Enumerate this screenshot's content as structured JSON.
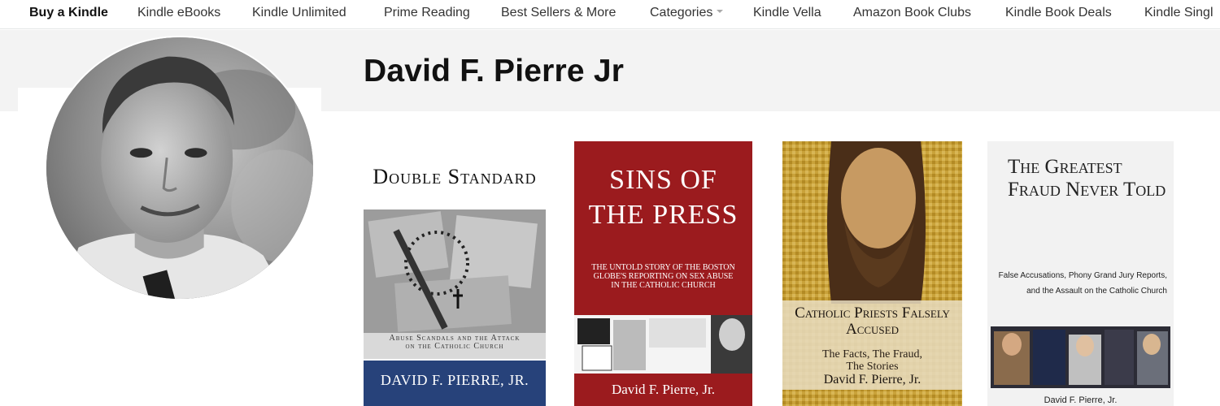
{
  "nav": {
    "items": [
      {
        "label": "Buy a Kindle",
        "active": true
      },
      {
        "label": "Kindle eBooks"
      },
      {
        "label": "Kindle Unlimited"
      },
      {
        "label": "Prime Reading"
      },
      {
        "label": "Best Sellers & More"
      },
      {
        "label": "Categories",
        "dropdown": true
      },
      {
        "label": "Kindle Vella"
      },
      {
        "label": "Amazon Book Clubs"
      },
      {
        "label": "Kindle Book Deals"
      },
      {
        "label": "Kindle Singl"
      }
    ]
  },
  "author": {
    "name": "David F. Pierre Jr"
  },
  "books": [
    {
      "title": "Double Standard",
      "subtitle": "Abuse Scandals and the Attack on the Catholic Church",
      "author": "DAVID F. PIERRE, JR."
    },
    {
      "title": "SINS OF THE PRESS",
      "subtitle": "The Untold Story of the Boston Globe's Reporting on Sex Abuse in the Catholic Church",
      "author": "David F. Pierre, Jr."
    },
    {
      "title": "Catholic Priests Falsely Accused",
      "subtitle": "The Facts, The Fraud, The Stories",
      "author": "David F. Pierre, Jr."
    },
    {
      "title": "The Greatest Fraud Never Told",
      "subtitle": "False Accusations, Phony Grand Jury Reports, and the Assault on the Catholic Church",
      "author": "David F. Pierre, Jr."
    }
  ],
  "colors": {
    "band": "#f3f3f3",
    "sins_cover": "#9b1b1e",
    "double_standard_bar": "#27427a"
  }
}
